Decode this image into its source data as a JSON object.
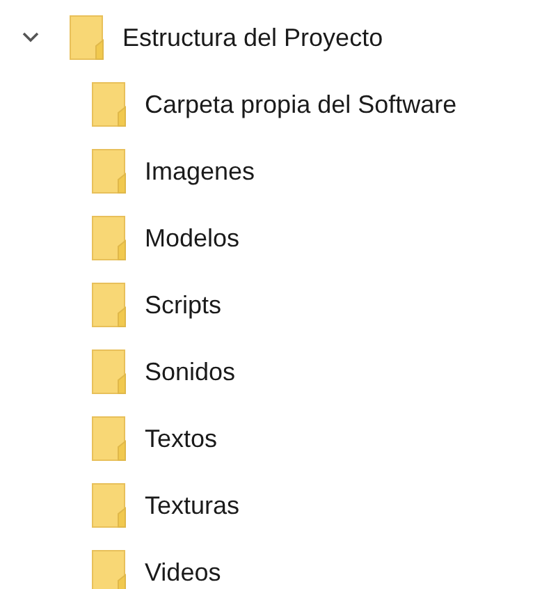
{
  "tree": [
    {
      "label": "Estructura del Proyecto",
      "expanded": true,
      "children": [
        {
          "label": "Carpeta propia del Software"
        },
        {
          "label": "Imagenes"
        },
        {
          "label": "Modelos"
        },
        {
          "label": "Scripts"
        },
        {
          "label": "Sonidos"
        },
        {
          "label": "Textos"
        },
        {
          "label": "Texturas"
        },
        {
          "label": "Videos"
        }
      ]
    }
  ]
}
